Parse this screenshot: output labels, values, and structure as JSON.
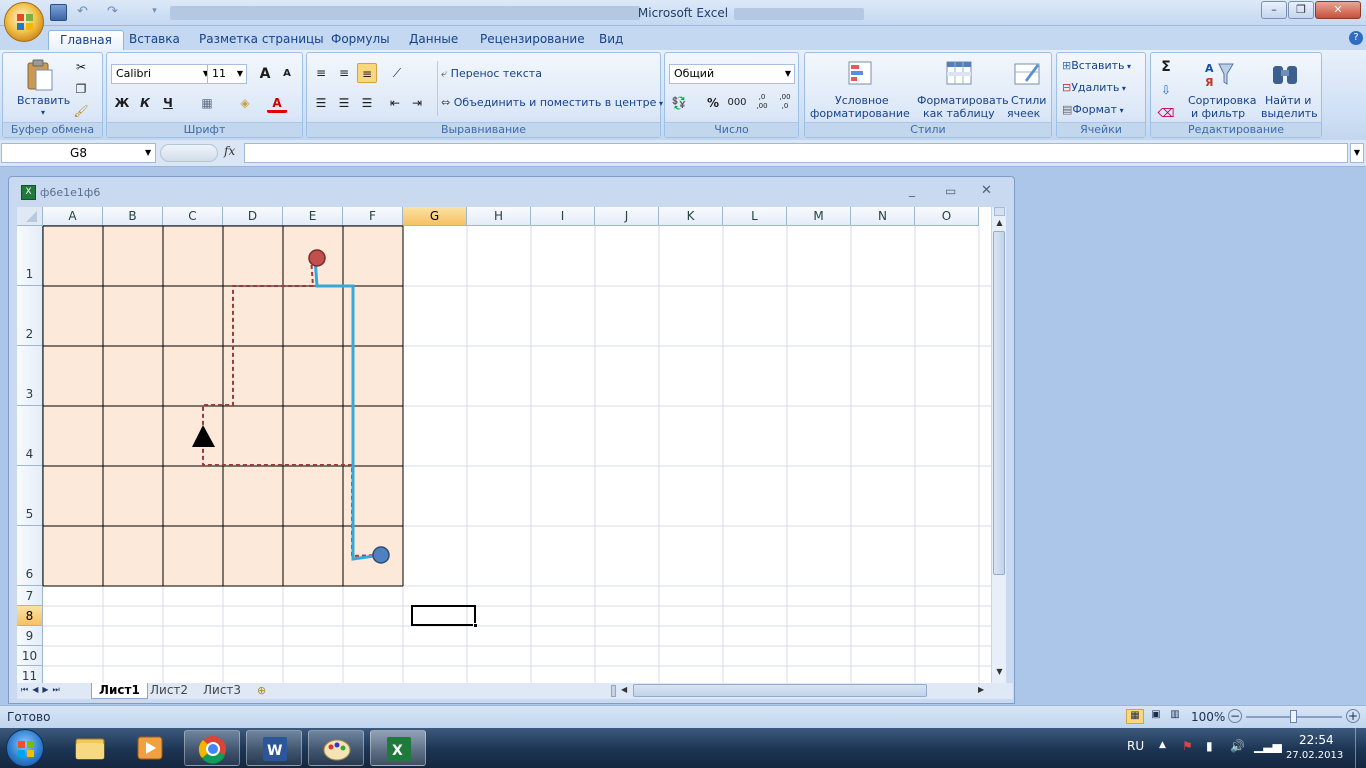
{
  "window": {
    "title": "Microsoft Excel"
  },
  "ribbon": {
    "tabs": [
      "Главная",
      "Вставка",
      "Разметка страницы",
      "Формулы",
      "Данные",
      "Рецензирование",
      "Вид"
    ],
    "active_tab": "Главная",
    "clipboard": {
      "paste": "Вставить",
      "label": "Буфер обмена"
    },
    "font": {
      "name": "Calibri",
      "size": "11",
      "bold": "Ж",
      "italic": "К",
      "underline": "Ч",
      "grow": "A",
      "shrink": "A",
      "label": "Шрифт"
    },
    "alignment": {
      "wrap": "Перенос текста",
      "merge": "Объединить и поместить в центре",
      "label": "Выравнивание"
    },
    "number": {
      "format": "Общий",
      "percent": "%",
      "thousands": "000",
      "inc": ",0 ,00",
      "dec": ",00 ,0",
      "label": "Число"
    },
    "styles": {
      "conditional_1": "Условное",
      "conditional_2": "форматирование",
      "table_1": "Форматировать",
      "table_2": "как таблицу",
      "cell_1": "Стили",
      "cell_2": "ячеек",
      "label": "Стили"
    },
    "cells": {
      "insert": "Вставить",
      "delete": "Удалить",
      "format": "Формат",
      "label": "Ячейки"
    },
    "editing": {
      "sum": "Σ",
      "sort_1": "Сортировка",
      "sort_2": "и фильтр",
      "find_1": "Найти и",
      "find_2": "выделить",
      "label": "Редактирование"
    }
  },
  "formula_bar": {
    "name_box": "G8",
    "fx": "fx",
    "formula": ""
  },
  "workbook": {
    "title": "ф6е1е1ф6",
    "columns": [
      "A",
      "B",
      "C",
      "D",
      "E",
      "F",
      "G",
      "H",
      "I",
      "J",
      "K",
      "L",
      "M",
      "N",
      "O"
    ],
    "rows": [
      "1",
      "2",
      "3",
      "4",
      "5",
      "6",
      "7",
      "8",
      "9",
      "10",
      "11"
    ],
    "selected_cell": "G8",
    "sheets": [
      "Лист1",
      "Лист2",
      "Лист3"
    ],
    "active_sheet": "Лист1"
  },
  "colors": {
    "grid_fill": "#fde9d9",
    "red_marker": "#c0504d",
    "blue_marker": "#4f81bd",
    "blue_path": "#33aadd",
    "red_path": "#9b3b3b"
  },
  "status": {
    "ready": "Готово",
    "zoom": "100%"
  },
  "taskbar": {
    "lang": "RU",
    "time": "22:54",
    "date": "27.02.2013"
  }
}
